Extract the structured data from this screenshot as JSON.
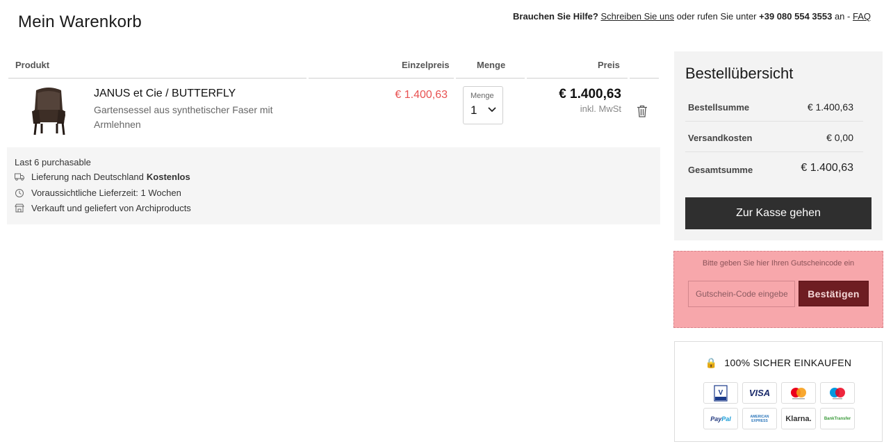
{
  "page": {
    "title": "Mein Warenkorb"
  },
  "help": {
    "prefix": "Brauchen Sie Hilfe?",
    "write_link": "Schreiben Sie uns",
    "middle": "oder rufen Sie unter",
    "phone": "+39 080 554 3553",
    "suffix": "an -",
    "faq_link": "FAQ"
  },
  "table": {
    "col_product": "Produkt",
    "col_unit_price": "Einzelpreis",
    "col_quantity": "Menge",
    "col_price": "Preis"
  },
  "item": {
    "brand": "JANUS et Cie",
    "separator": " / ",
    "model": "BUTTERFLY",
    "description": "Gartensessel aus synthetischer Faser mit Armlehnen",
    "unit_price": "€ 1.400,63",
    "quantity_label": "Menge",
    "quantity": "1",
    "total_price": "€ 1.400,63",
    "vat_note": "inkl. MwSt"
  },
  "info": {
    "stock": "Last 6 purchasable",
    "delivery_text": "Lieferung nach Deutschland",
    "delivery_cost": "Kostenlos",
    "delivery_time": "Voraussichtliche Lieferzeit: 1 Wochen",
    "seller": "Verkauft und geliefert von Archiproducts"
  },
  "summary": {
    "title": "Bestellübersicht",
    "subtotal_label": "Bestellsumme",
    "subtotal_value": "€ 1.400,63",
    "shipping_label": "Versandkosten",
    "shipping_value": "€ 0,00",
    "total_label": "Gesamtsumme",
    "total_value": "€ 1.400,63",
    "checkout_label": "Zur Kasse gehen"
  },
  "coupon": {
    "hint": "Bitte geben Sie hier Ihren Gutscheincode ein",
    "placeholder": "Gutschein-Code eingeben",
    "button": "Bestätigen"
  },
  "secure": {
    "title": "100% SICHER EINKAUFEN",
    "payments": [
      "V PAY",
      "VISA",
      "mastercard",
      "maestro",
      "PayPal",
      "AMERICAN EXPRESS",
      "Klarna.",
      "BankTransfer"
    ]
  },
  "colors": {
    "sale_price": "#e85151",
    "checkout_bg": "#2f2f2f",
    "coupon_bg": "#f7a7ab",
    "coupon_button": "#6e1d22"
  }
}
